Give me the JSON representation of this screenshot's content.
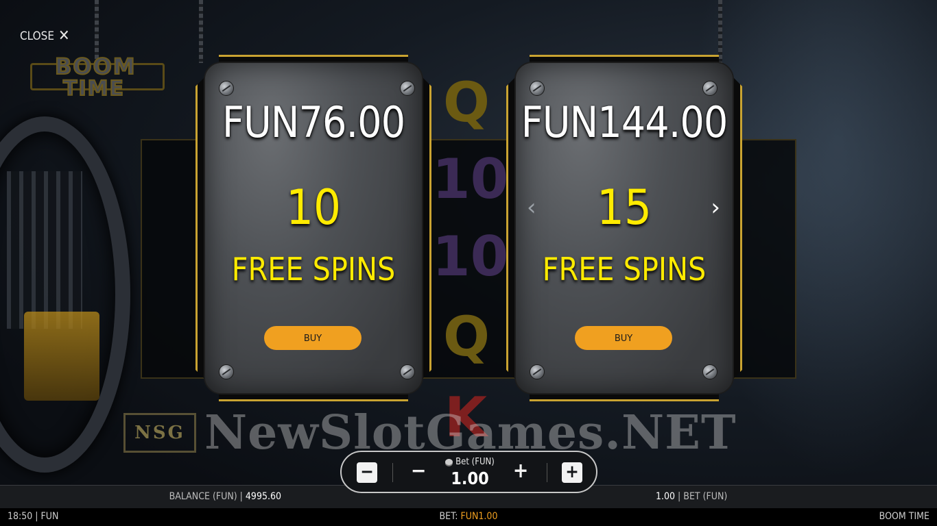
{
  "close_label": "CLOSE",
  "close_icon": "close-x-icon",
  "logo": {
    "line1": "BOOM",
    "line2": "TIME"
  },
  "reel_symbols": [
    "Q",
    "10",
    "10",
    "Q",
    "K"
  ],
  "offers": [
    {
      "price": "FUN76.00",
      "spins": "10",
      "label": "FREE SPINS",
      "buy_label": "BUY"
    },
    {
      "price": "FUN144.00",
      "spins": "15",
      "label": "FREE SPINS",
      "buy_label": "BUY"
    }
  ],
  "arrows": {
    "left": "‹",
    "right": "›"
  },
  "watermark": {
    "badge": "NSG",
    "text": "NewSlotGames.NET"
  },
  "bet_control": {
    "label": "Bet (FUN)",
    "value": "1.00",
    "decrease_max": "−",
    "decrease": "−",
    "increase": "+",
    "increase_max": "+"
  },
  "info_bar": {
    "balance_label": "BALANCE (FUN)",
    "separator": "|",
    "balance_value": "4995.60",
    "bet_value": "1.00",
    "bet_label": "BET  (FUN)"
  },
  "status_bar": {
    "time": "18:50",
    "currency": "FUN",
    "bet_label": "BET:",
    "bet_value": "FUN1.00",
    "game_name": "BOOM TIME"
  },
  "colors": {
    "accent": "#f0a020",
    "spins_yellow": "#ffeb00",
    "frame_gold": "#c9a331"
  }
}
